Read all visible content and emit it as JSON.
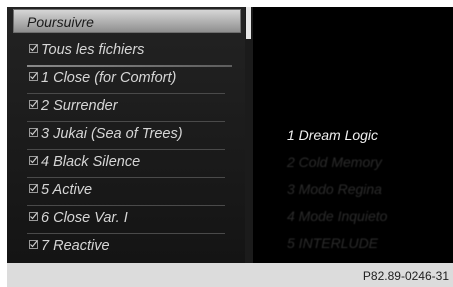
{
  "header": {
    "title": "Poursuivre"
  },
  "list": {
    "items": [
      {
        "label": "Tous les fichiers"
      },
      {
        "label": "1  Close (for Comfort)"
      },
      {
        "label": "2  Surrender"
      },
      {
        "label": "3  Jukai (Sea of Trees)"
      },
      {
        "label": "4  Black Silence"
      },
      {
        "label": "5  Active"
      },
      {
        "label": "6  Close Var. I"
      },
      {
        "label": "7  Reactive"
      }
    ]
  },
  "tracks": [
    {
      "label": "1  Dream Logic"
    },
    {
      "label": "2  Cold Memory"
    },
    {
      "label": "3  Modo Regina"
    },
    {
      "label": "4  Mode Inquieto"
    },
    {
      "label": "5  INTERLUDE"
    }
  ],
  "footer": {
    "reference": "P82.89-0246-31"
  },
  "colors": {
    "screen_bg": "#0d0d0d",
    "highlight": "#d9d9d9",
    "text": "#d6d6d6",
    "footer": "#dcdcdc"
  }
}
